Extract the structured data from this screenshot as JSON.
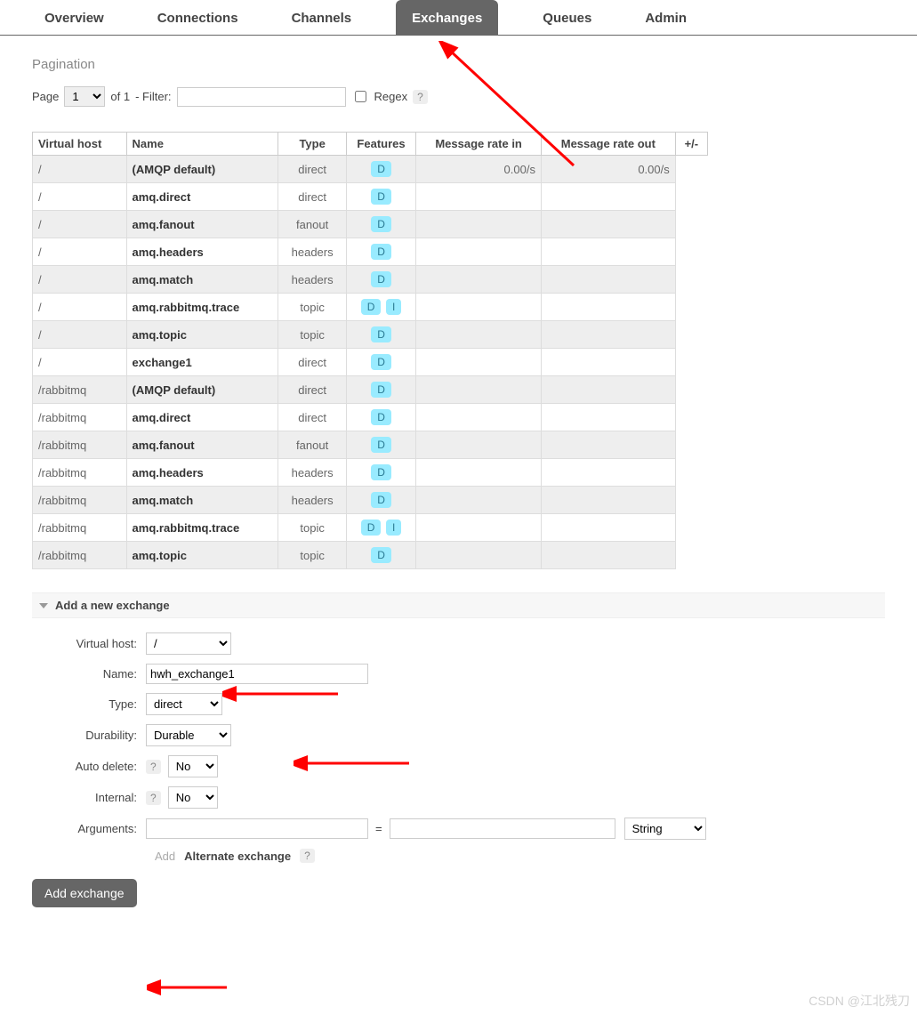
{
  "tabs": {
    "overview": "Overview",
    "connections": "Connections",
    "channels": "Channels",
    "exchanges": "Exchanges",
    "queues": "Queues",
    "admin": "Admin"
  },
  "pagination": {
    "title": "Pagination",
    "page_label": "Page",
    "page_value": "1",
    "of_label": "of 1",
    "filter_label": "- Filter:",
    "filter_value": "",
    "regex_label": "Regex",
    "help": "?"
  },
  "table": {
    "headers": {
      "vhost": "Virtual host",
      "name": "Name",
      "type": "Type",
      "features": "Features",
      "rate_in": "Message rate in",
      "rate_out": "Message rate out",
      "pm": "+/-"
    },
    "rows": [
      {
        "vhost": "/",
        "name": "(AMQP default)",
        "type": "direct",
        "features": [
          "D"
        ],
        "in": "0.00/s",
        "out": "0.00/s"
      },
      {
        "vhost": "/",
        "name": "amq.direct",
        "type": "direct",
        "features": [
          "D"
        ],
        "in": "",
        "out": ""
      },
      {
        "vhost": "/",
        "name": "amq.fanout",
        "type": "fanout",
        "features": [
          "D"
        ],
        "in": "",
        "out": ""
      },
      {
        "vhost": "/",
        "name": "amq.headers",
        "type": "headers",
        "features": [
          "D"
        ],
        "in": "",
        "out": ""
      },
      {
        "vhost": "/",
        "name": "amq.match",
        "type": "headers",
        "features": [
          "D"
        ],
        "in": "",
        "out": ""
      },
      {
        "vhost": "/",
        "name": "amq.rabbitmq.trace",
        "type": "topic",
        "features": [
          "D",
          "I"
        ],
        "in": "",
        "out": ""
      },
      {
        "vhost": "/",
        "name": "amq.topic",
        "type": "topic",
        "features": [
          "D"
        ],
        "in": "",
        "out": ""
      },
      {
        "vhost": "/",
        "name": "exchange1",
        "type": "direct",
        "features": [
          "D"
        ],
        "in": "",
        "out": ""
      },
      {
        "vhost": "/rabbitmq",
        "name": "(AMQP default)",
        "type": "direct",
        "features": [
          "D"
        ],
        "in": "",
        "out": ""
      },
      {
        "vhost": "/rabbitmq",
        "name": "amq.direct",
        "type": "direct",
        "features": [
          "D"
        ],
        "in": "",
        "out": ""
      },
      {
        "vhost": "/rabbitmq",
        "name": "amq.fanout",
        "type": "fanout",
        "features": [
          "D"
        ],
        "in": "",
        "out": ""
      },
      {
        "vhost": "/rabbitmq",
        "name": "amq.headers",
        "type": "headers",
        "features": [
          "D"
        ],
        "in": "",
        "out": ""
      },
      {
        "vhost": "/rabbitmq",
        "name": "amq.match",
        "type": "headers",
        "features": [
          "D"
        ],
        "in": "",
        "out": ""
      },
      {
        "vhost": "/rabbitmq",
        "name": "amq.rabbitmq.trace",
        "type": "topic",
        "features": [
          "D",
          "I"
        ],
        "in": "",
        "out": ""
      },
      {
        "vhost": "/rabbitmq",
        "name": "amq.topic",
        "type": "topic",
        "features": [
          "D"
        ],
        "in": "",
        "out": ""
      }
    ]
  },
  "add": {
    "title": "Add a new exchange",
    "labels": {
      "vhost": "Virtual host:",
      "name": "Name:",
      "type": "Type:",
      "durability": "Durability:",
      "auto_delete": "Auto delete:",
      "internal": "Internal:",
      "arguments": "Arguments:"
    },
    "values": {
      "vhost": "/",
      "name": "hwh_exchange1",
      "type": "direct",
      "durability": "Durable",
      "auto_delete": "No",
      "internal": "No",
      "arg_key": "",
      "arg_val": "",
      "arg_type": "String"
    },
    "args_add_label": "Add",
    "alt_exchange_label": "Alternate exchange",
    "help": "?",
    "submit": "Add exchange"
  },
  "watermark": "CSDN @江北残刀"
}
